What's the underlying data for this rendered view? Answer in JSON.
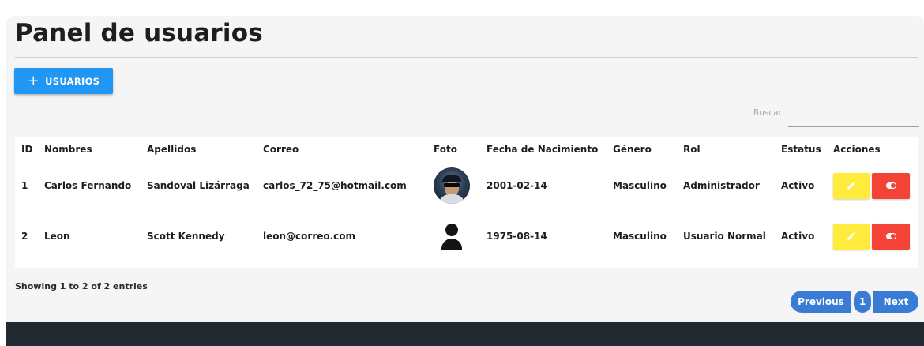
{
  "page": {
    "title": "Panel de usuarios"
  },
  "toolbar": {
    "add_icon": "plus-icon",
    "add_label": "USUARIOS"
  },
  "search": {
    "label": "Buscar",
    "value": ""
  },
  "table": {
    "columns": [
      "ID",
      "Nombres",
      "Apellidos",
      "Correo",
      "Foto",
      "Fecha de Nacimiento",
      "Género",
      "Rol",
      "Estatus",
      "Acciones"
    ],
    "rows": [
      {
        "id": "1",
        "nombres": "Carlos Fernando",
        "apellidos": "Sandoval Lizárraga",
        "correo": "carlos_72_75@hotmail.com",
        "foto": "user-photo",
        "fecha": "2001-02-14",
        "genero": "Masculino",
        "rol": "Administrador",
        "estatus": "Activo"
      },
      {
        "id": "2",
        "nombres": "Leon",
        "apellidos": "Scott Kennedy",
        "correo": "leon@correo.com",
        "foto": "generic-user-icon",
        "fecha": "1975-08-14",
        "genero": "Masculino",
        "rol": "Usuario Normal",
        "estatus": "Activo"
      }
    ],
    "action_icons": [
      "pencil-icon",
      "toggle-icon"
    ]
  },
  "footer_info": {
    "showing": "Showing 1 to 2 of 2 entries"
  },
  "pagination": {
    "previous": "Previous",
    "current": "1",
    "next": "Next"
  },
  "colors": {
    "primary": "#2196f3",
    "edit": "#ffeb3b",
    "toggle": "#f44336",
    "pager": "#3a7bd5",
    "footer": "#222a31"
  }
}
